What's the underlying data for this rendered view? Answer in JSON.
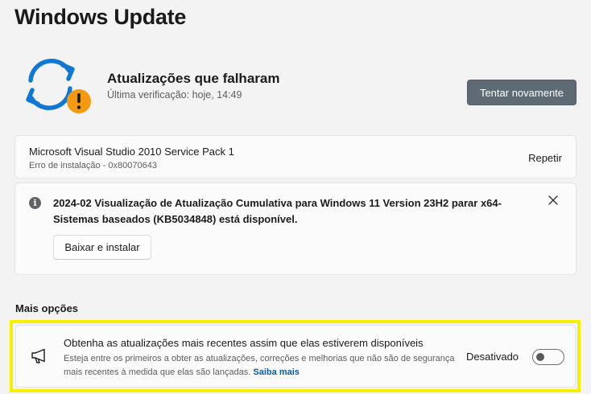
{
  "page": {
    "title": "Windows Update"
  },
  "status": {
    "icon": "sync-warning-icon",
    "title": "Atualizações que falharam",
    "subtitle": "Última verificação: hoje, 14:49",
    "retry_button": "Tentar novamente"
  },
  "failed_update": {
    "name": "Microsoft Visual Studio 2010 Service Pack 1",
    "error": "Erro de instalação - 0x80070643",
    "action": "Repetir"
  },
  "info_banner": {
    "icon": "info-icon",
    "text": "2024-02 Visualização de Atualização Cumulativa para Windows 11 Version 23H2 parar x64-Sistemas baseados (KB5034848) está disponível.",
    "install_button": "Baixar e instalar",
    "dismiss_icon": "close-icon"
  },
  "more_options": {
    "label": "Mais opções",
    "option": {
      "icon": "megaphone-icon",
      "title": "Obtenha as atualizações mais recentes assim que elas estiverem disponíveis",
      "description": "Esteja entre os primeiros a obter as atualizações, correções e melhorias que não são de segurança mais recentes à medida que elas são lançadas.",
      "link": "Saiba mais",
      "toggle_label": "Desativado",
      "toggle_on": false
    }
  },
  "colors": {
    "background": "#f3f3f3",
    "card": "#fbfbfb",
    "accent_blue": "#0f78d4",
    "warning_orange": "#f59a0f",
    "highlight_yellow": "#f7f000",
    "retry_button": "#5f6b74"
  }
}
